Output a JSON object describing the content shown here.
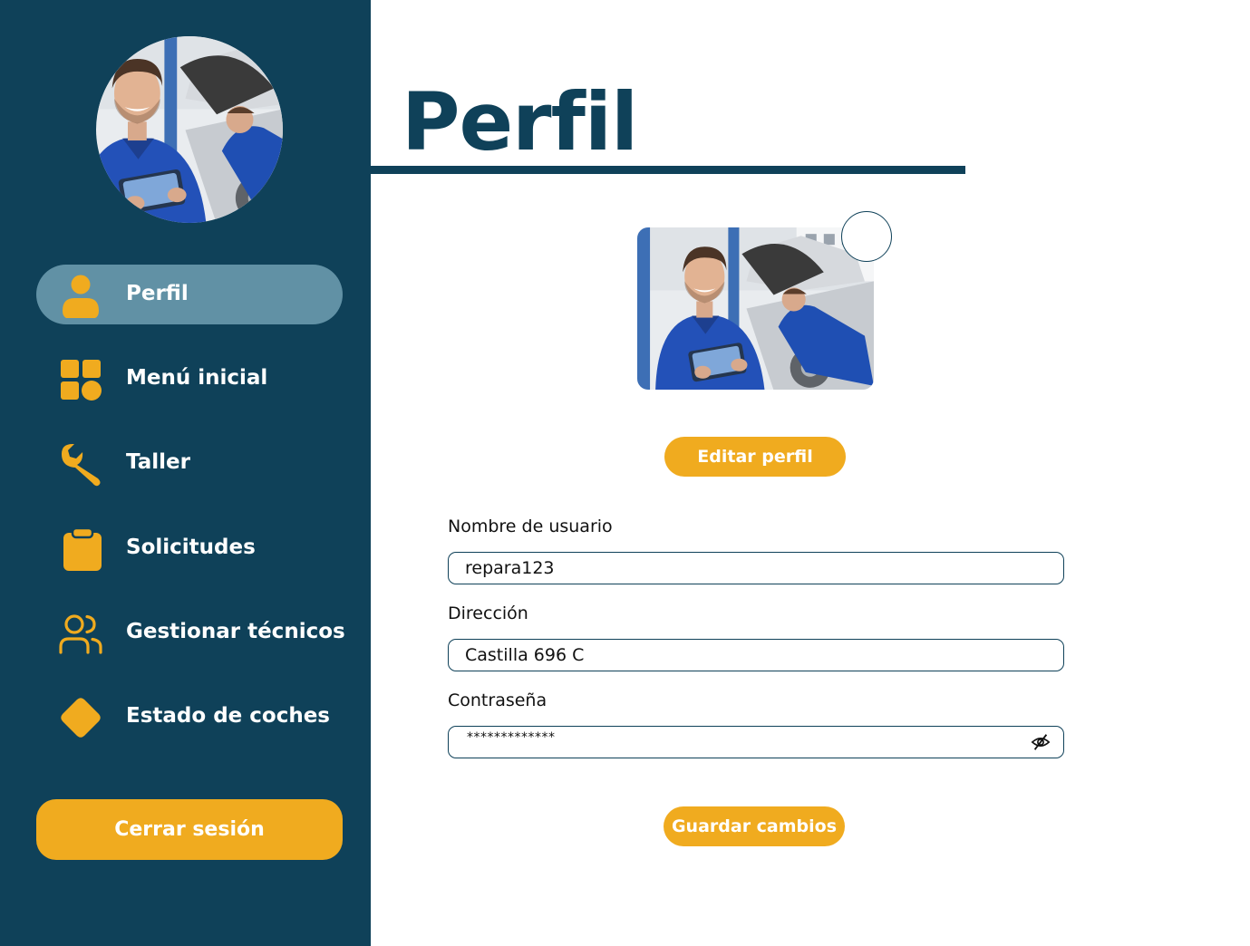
{
  "sidebar": {
    "avatar": "mechanic-avatar",
    "items": [
      {
        "label": "Perfil",
        "icon": "user-icon",
        "active": true
      },
      {
        "label": "Menú inicial",
        "icon": "grid-icon",
        "active": false
      },
      {
        "label": "Taller",
        "icon": "wrench-icon",
        "active": false
      },
      {
        "label": "Solicitudes",
        "icon": "clipboard-icon",
        "active": false
      },
      {
        "label": "Gestionar técnicos",
        "icon": "users-icon",
        "active": false
      },
      {
        "label": "Estado de coches",
        "icon": "diamond-icon",
        "active": false
      }
    ],
    "logout_label": "Cerrar sesión"
  },
  "main": {
    "title": "Perfil",
    "edit_profile_label": "Editar perfil",
    "fields": {
      "username": {
        "label": "Nombre de usuario",
        "value": "repara123"
      },
      "address": {
        "label": "Dirección",
        "value": "Castilla 696 C"
      },
      "password": {
        "label": "Contraseña",
        "value": "*************",
        "toggle_icon": "eye-off-icon"
      }
    },
    "save_label": "Guardar cambios"
  },
  "colors": {
    "sidebar_bg": "#0f4159",
    "active_item_bg": "#6191a5",
    "accent": "#f0ab1f",
    "primary_text": "#0f4159"
  }
}
